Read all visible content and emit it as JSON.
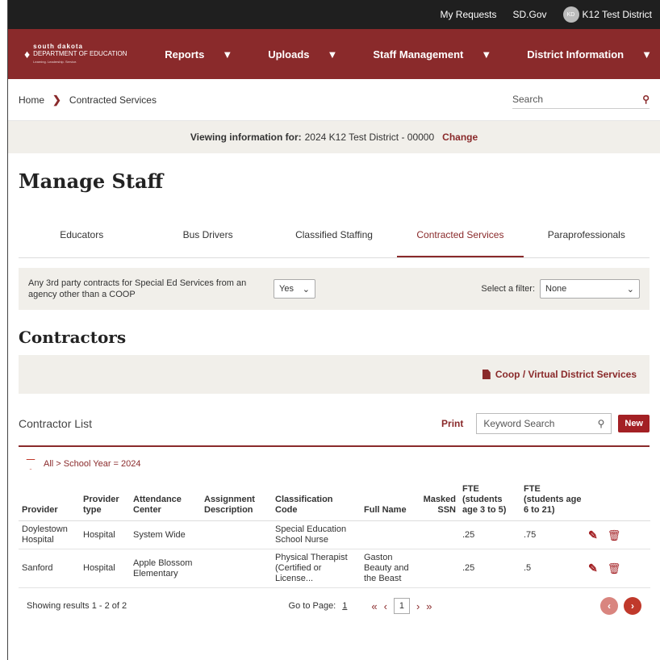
{
  "topbar": {
    "my_requests": "My Requests",
    "sdgov": "SD.Gov",
    "avatar_initials": "KD",
    "district": "K12 Test District"
  },
  "logo": {
    "line1": "south dakota",
    "line2": "DEPARTMENT OF EDUCATION",
    "tagline": "Learning. Leadership. Service."
  },
  "nav": {
    "reports": "Reports",
    "uploads": "Uploads",
    "staff": "Staff Management",
    "district": "District Information"
  },
  "breadcrumb": {
    "home": "Home",
    "current": "Contracted Services"
  },
  "search": {
    "placeholder": "Search"
  },
  "viewing": {
    "label": "Viewing information for:",
    "value": "2024 K12 Test District - 00000",
    "change": "Change"
  },
  "page_title": "Manage Staff",
  "tabs": [
    "Educators",
    "Bus Drivers",
    "Classified Staffing",
    "Contracted Services",
    "Paraprofessionals"
  ],
  "question": {
    "text": "Any 3rd party contracts for Special Ed Services from an agency other than a COOP",
    "value": "Yes"
  },
  "filter": {
    "label": "Select a filter:",
    "value": "None"
  },
  "contractors_title": "Contractors",
  "coop_link": "Coop / Virtual District Services",
  "list": {
    "title": "Contractor List",
    "print": "Print",
    "keyword_placeholder": "Keyword Search",
    "new": "New",
    "criteria": "All > School Year = 2024"
  },
  "columns": [
    "Provider",
    "Provider type",
    "Attendance Center",
    "Assignment Description",
    "Classification Code",
    "Full Name",
    "Masked SSN",
    "FTE (students age 3 to 5)",
    "FTE (students age 6 to 21)"
  ],
  "rows": [
    {
      "provider": "Doylestown Hospital",
      "type": "Hospital",
      "center": "System Wide",
      "desc": "",
      "code": "Special Education School Nurse",
      "name": "",
      "ssn": "",
      "fte35": ".25",
      "fte621": ".75"
    },
    {
      "provider": "Sanford",
      "type": "Hospital",
      "center": "Apple Blossom Elementary",
      "desc": "",
      "code": "Physical Therapist (Certified or License...",
      "name": "Gaston Beauty and the Beast",
      "ssn": "",
      "fte35": ".25",
      "fte621": ".5"
    }
  ],
  "pager": {
    "summary": "Showing results 1 - 2 of 2",
    "goto": "Go to Page:",
    "goto_value": "1",
    "current": "1"
  }
}
